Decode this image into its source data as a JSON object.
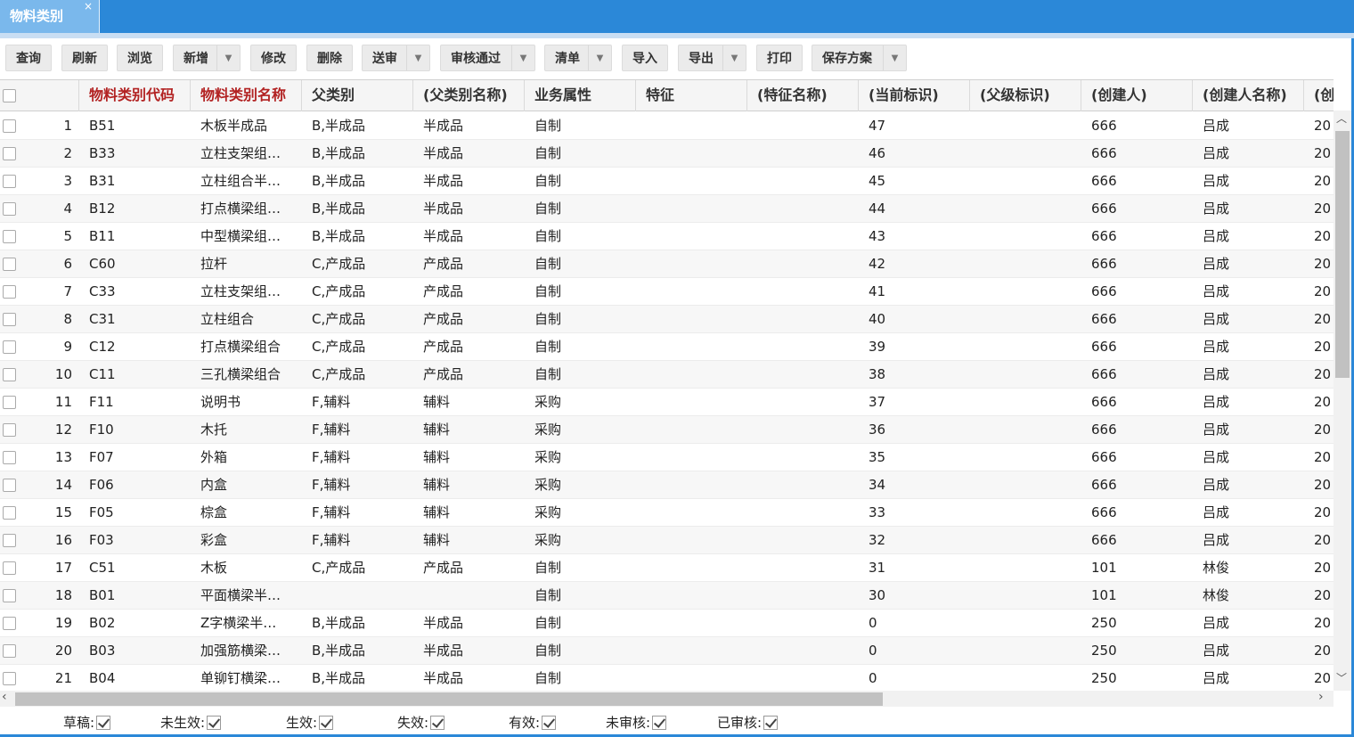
{
  "tab": {
    "label": "物料类别",
    "close": "×"
  },
  "toolbar": {
    "buttons": [
      {
        "label": "查询",
        "dropdown": false
      },
      {
        "label": "刷新",
        "dropdown": false
      },
      {
        "label": "浏览",
        "dropdown": false
      },
      {
        "label": "新增",
        "dropdown": true
      },
      {
        "label": "修改",
        "dropdown": false
      },
      {
        "label": "删除",
        "dropdown": false
      },
      {
        "label": "送审",
        "dropdown": true
      },
      {
        "label": "审核通过",
        "dropdown": true
      },
      {
        "label": "清单",
        "dropdown": true
      },
      {
        "label": "导入",
        "dropdown": false
      },
      {
        "label": "导出",
        "dropdown": true
      },
      {
        "label": "打印",
        "dropdown": false
      },
      {
        "label": "保存方案",
        "dropdown": true
      }
    ]
  },
  "grid": {
    "columns": [
      "物料类别代码",
      "物料类别名称",
      "父类别",
      "(父类别名称)",
      "业务属性",
      "特征",
      "(特征名称)",
      "(当前标识)",
      "(父级标识)",
      "(创建人)",
      "(创建人名称)",
      "(创建时"
    ],
    "rows": [
      {
        "n": "1",
        "code": "B51",
        "name": "木板半成品",
        "parent": "B,半成品",
        "parent_name": "半成品",
        "attr": "自制",
        "feat": "",
        "feat_name": "",
        "cur_id": "47",
        "parent_id": "",
        "creator": "666",
        "creator_name": "吕成",
        "created": "20"
      },
      {
        "n": "2",
        "code": "B33",
        "name": "立柱支架组…",
        "parent": "B,半成品",
        "parent_name": "半成品",
        "attr": "自制",
        "feat": "",
        "feat_name": "",
        "cur_id": "46",
        "parent_id": "",
        "creator": "666",
        "creator_name": "吕成",
        "created": "20"
      },
      {
        "n": "3",
        "code": "B31",
        "name": "立柱组合半…",
        "parent": "B,半成品",
        "parent_name": "半成品",
        "attr": "自制",
        "feat": "",
        "feat_name": "",
        "cur_id": "45",
        "parent_id": "",
        "creator": "666",
        "creator_name": "吕成",
        "created": "20"
      },
      {
        "n": "4",
        "code": "B12",
        "name": "打点横梁组…",
        "parent": "B,半成品",
        "parent_name": "半成品",
        "attr": "自制",
        "feat": "",
        "feat_name": "",
        "cur_id": "44",
        "parent_id": "",
        "creator": "666",
        "creator_name": "吕成",
        "created": "20"
      },
      {
        "n": "5",
        "code": "B11",
        "name": "中型横梁组…",
        "parent": "B,半成品",
        "parent_name": "半成品",
        "attr": "自制",
        "feat": "",
        "feat_name": "",
        "cur_id": "43",
        "parent_id": "",
        "creator": "666",
        "creator_name": "吕成",
        "created": "20"
      },
      {
        "n": "6",
        "code": "C60",
        "name": "拉杆",
        "parent": "C,产成品",
        "parent_name": "产成品",
        "attr": "自制",
        "feat": "",
        "feat_name": "",
        "cur_id": "42",
        "parent_id": "",
        "creator": "666",
        "creator_name": "吕成",
        "created": "20"
      },
      {
        "n": "7",
        "code": "C33",
        "name": "立柱支架组…",
        "parent": "C,产成品",
        "parent_name": "产成品",
        "attr": "自制",
        "feat": "",
        "feat_name": "",
        "cur_id": "41",
        "parent_id": "",
        "creator": "666",
        "creator_name": "吕成",
        "created": "20"
      },
      {
        "n": "8",
        "code": "C31",
        "name": "立柱组合",
        "parent": "C,产成品",
        "parent_name": "产成品",
        "attr": "自制",
        "feat": "",
        "feat_name": "",
        "cur_id": "40",
        "parent_id": "",
        "creator": "666",
        "creator_name": "吕成",
        "created": "20"
      },
      {
        "n": "9",
        "code": "C12",
        "name": "打点横梁组合",
        "parent": "C,产成品",
        "parent_name": "产成品",
        "attr": "自制",
        "feat": "",
        "feat_name": "",
        "cur_id": "39",
        "parent_id": "",
        "creator": "666",
        "creator_name": "吕成",
        "created": "20"
      },
      {
        "n": "10",
        "code": "C11",
        "name": "三孔横梁组合",
        "parent": "C,产成品",
        "parent_name": "产成品",
        "attr": "自制",
        "feat": "",
        "feat_name": "",
        "cur_id": "38",
        "parent_id": "",
        "creator": "666",
        "creator_name": "吕成",
        "created": "20"
      },
      {
        "n": "11",
        "code": "F11",
        "name": "说明书",
        "parent": "F,辅料",
        "parent_name": "辅料",
        "attr": "采购",
        "feat": "",
        "feat_name": "",
        "cur_id": "37",
        "parent_id": "",
        "creator": "666",
        "creator_name": "吕成",
        "created": "20"
      },
      {
        "n": "12",
        "code": "F10",
        "name": "木托",
        "parent": "F,辅料",
        "parent_name": "辅料",
        "attr": "采购",
        "feat": "",
        "feat_name": "",
        "cur_id": "36",
        "parent_id": "",
        "creator": "666",
        "creator_name": "吕成",
        "created": "20"
      },
      {
        "n": "13",
        "code": "F07",
        "name": "外箱",
        "parent": "F,辅料",
        "parent_name": "辅料",
        "attr": "采购",
        "feat": "",
        "feat_name": "",
        "cur_id": "35",
        "parent_id": "",
        "creator": "666",
        "creator_name": "吕成",
        "created": "20"
      },
      {
        "n": "14",
        "code": "F06",
        "name": "内盒",
        "parent": "F,辅料",
        "parent_name": "辅料",
        "attr": "采购",
        "feat": "",
        "feat_name": "",
        "cur_id": "34",
        "parent_id": "",
        "creator": "666",
        "creator_name": "吕成",
        "created": "20"
      },
      {
        "n": "15",
        "code": "F05",
        "name": "棕盒",
        "parent": "F,辅料",
        "parent_name": "辅料",
        "attr": "采购",
        "feat": "",
        "feat_name": "",
        "cur_id": "33",
        "parent_id": "",
        "creator": "666",
        "creator_name": "吕成",
        "created": "20"
      },
      {
        "n": "16",
        "code": "F03",
        "name": "彩盒",
        "parent": "F,辅料",
        "parent_name": "辅料",
        "attr": "采购",
        "feat": "",
        "feat_name": "",
        "cur_id": "32",
        "parent_id": "",
        "creator": "666",
        "creator_name": "吕成",
        "created": "20"
      },
      {
        "n": "17",
        "code": "C51",
        "name": "木板",
        "parent": "C,产成品",
        "parent_name": "产成品",
        "attr": "自制",
        "feat": "",
        "feat_name": "",
        "cur_id": "31",
        "parent_id": "",
        "creator": "101",
        "creator_name": "林俊",
        "created": "20"
      },
      {
        "n": "18",
        "code": "B01",
        "name": "平面横梁半…",
        "parent": "",
        "parent_name": "",
        "attr": "自制",
        "feat": "",
        "feat_name": "",
        "cur_id": "30",
        "parent_id": "",
        "creator": "101",
        "creator_name": "林俊",
        "created": "20"
      },
      {
        "n": "19",
        "code": "B02",
        "name": "Z字横梁半…",
        "parent": "B,半成品",
        "parent_name": "半成品",
        "attr": "自制",
        "feat": "",
        "feat_name": "",
        "cur_id": "0",
        "parent_id": "",
        "creator": "250",
        "creator_name": "吕成",
        "created": "20"
      },
      {
        "n": "20",
        "code": "B03",
        "name": "加强筋横梁…",
        "parent": "B,半成品",
        "parent_name": "半成品",
        "attr": "自制",
        "feat": "",
        "feat_name": "",
        "cur_id": "0",
        "parent_id": "",
        "creator": "250",
        "creator_name": "吕成",
        "created": "20"
      },
      {
        "n": "21",
        "code": "B04",
        "name": "单铆钉横梁…",
        "parent": "B,半成品",
        "parent_name": "半成品",
        "attr": "自制",
        "feat": "",
        "feat_name": "",
        "cur_id": "0",
        "parent_id": "",
        "creator": "250",
        "creator_name": "吕成",
        "created": "20"
      }
    ]
  },
  "filters": [
    {
      "label": "草稿:",
      "checked": true
    },
    {
      "label": "未生效:",
      "checked": true
    },
    {
      "label": "生效:",
      "checked": true
    },
    {
      "label": "失效:",
      "checked": true
    },
    {
      "label": "有效:",
      "checked": true
    },
    {
      "label": "未审核:",
      "checked": true
    },
    {
      "label": "已审核:",
      "checked": true
    }
  ],
  "colors": {
    "accent": "#2b88d8",
    "tab": "#7ab8ec",
    "header_red": "#b22222"
  }
}
